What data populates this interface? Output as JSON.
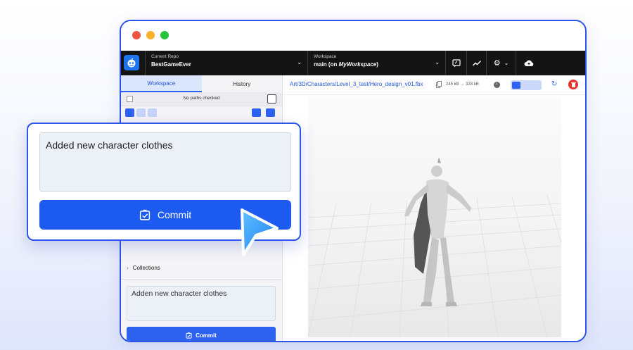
{
  "topbar": {
    "repo_label": "Current Repo",
    "repo_name": "BestGameEver",
    "workspace_label": "Workspace",
    "workspace_branch": "main",
    "workspace_on_prefix": "(on ",
    "workspace_name": "MyWorkspace",
    "workspace_on_suffix": ")"
  },
  "sidebar": {
    "tabs": [
      {
        "label": "Workspace",
        "active": true
      },
      {
        "label": "History",
        "active": false
      }
    ],
    "paths_status": "No paths checked",
    "collections_label": "Collections",
    "commit_message": "Adden new character clothes",
    "commit_label": "Commit"
  },
  "main": {
    "file_path": "Art/3D/Characters/Level_3_test/Hero_design_v01.fbx",
    "size_from": "245 kB",
    "size_arrow": "→",
    "size_to": "328 kB"
  },
  "overlay": {
    "commit_message": "Added new character clothes",
    "commit_label": "Commit"
  },
  "colors": {
    "accent": "#2d62f0",
    "topbar_bg": "#141414",
    "window_border": "#2f54eb",
    "delete_red": "#e5342b"
  },
  "icons": [
    "app-logo-icon",
    "chat-icon",
    "activity-chart-icon",
    "gear-icon",
    "cloud-upload-icon",
    "copy-icon",
    "info-icon",
    "history-icon",
    "trash-icon",
    "commit-check-icon",
    "cursor-pointer-icon"
  ]
}
